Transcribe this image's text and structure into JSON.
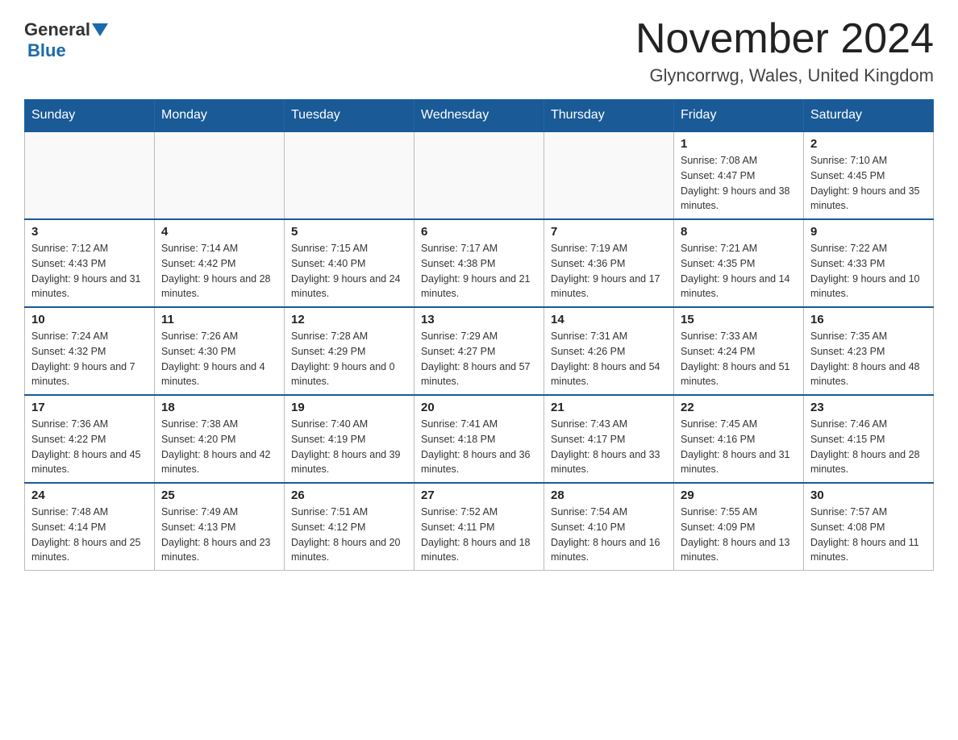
{
  "header": {
    "logo_general": "General",
    "logo_blue": "Blue",
    "month_year": "November 2024",
    "location": "Glyncorrwg, Wales, United Kingdom"
  },
  "weekdays": [
    "Sunday",
    "Monday",
    "Tuesday",
    "Wednesday",
    "Thursday",
    "Friday",
    "Saturday"
  ],
  "weeks": [
    [
      {
        "day": "",
        "info": ""
      },
      {
        "day": "",
        "info": ""
      },
      {
        "day": "",
        "info": ""
      },
      {
        "day": "",
        "info": ""
      },
      {
        "day": "",
        "info": ""
      },
      {
        "day": "1",
        "info": "Sunrise: 7:08 AM\nSunset: 4:47 PM\nDaylight: 9 hours and 38 minutes."
      },
      {
        "day": "2",
        "info": "Sunrise: 7:10 AM\nSunset: 4:45 PM\nDaylight: 9 hours and 35 minutes."
      }
    ],
    [
      {
        "day": "3",
        "info": "Sunrise: 7:12 AM\nSunset: 4:43 PM\nDaylight: 9 hours and 31 minutes."
      },
      {
        "day": "4",
        "info": "Sunrise: 7:14 AM\nSunset: 4:42 PM\nDaylight: 9 hours and 28 minutes."
      },
      {
        "day": "5",
        "info": "Sunrise: 7:15 AM\nSunset: 4:40 PM\nDaylight: 9 hours and 24 minutes."
      },
      {
        "day": "6",
        "info": "Sunrise: 7:17 AM\nSunset: 4:38 PM\nDaylight: 9 hours and 21 minutes."
      },
      {
        "day": "7",
        "info": "Sunrise: 7:19 AM\nSunset: 4:36 PM\nDaylight: 9 hours and 17 minutes."
      },
      {
        "day": "8",
        "info": "Sunrise: 7:21 AM\nSunset: 4:35 PM\nDaylight: 9 hours and 14 minutes."
      },
      {
        "day": "9",
        "info": "Sunrise: 7:22 AM\nSunset: 4:33 PM\nDaylight: 9 hours and 10 minutes."
      }
    ],
    [
      {
        "day": "10",
        "info": "Sunrise: 7:24 AM\nSunset: 4:32 PM\nDaylight: 9 hours and 7 minutes."
      },
      {
        "day": "11",
        "info": "Sunrise: 7:26 AM\nSunset: 4:30 PM\nDaylight: 9 hours and 4 minutes."
      },
      {
        "day": "12",
        "info": "Sunrise: 7:28 AM\nSunset: 4:29 PM\nDaylight: 9 hours and 0 minutes."
      },
      {
        "day": "13",
        "info": "Sunrise: 7:29 AM\nSunset: 4:27 PM\nDaylight: 8 hours and 57 minutes."
      },
      {
        "day": "14",
        "info": "Sunrise: 7:31 AM\nSunset: 4:26 PM\nDaylight: 8 hours and 54 minutes."
      },
      {
        "day": "15",
        "info": "Sunrise: 7:33 AM\nSunset: 4:24 PM\nDaylight: 8 hours and 51 minutes."
      },
      {
        "day": "16",
        "info": "Sunrise: 7:35 AM\nSunset: 4:23 PM\nDaylight: 8 hours and 48 minutes."
      }
    ],
    [
      {
        "day": "17",
        "info": "Sunrise: 7:36 AM\nSunset: 4:22 PM\nDaylight: 8 hours and 45 minutes."
      },
      {
        "day": "18",
        "info": "Sunrise: 7:38 AM\nSunset: 4:20 PM\nDaylight: 8 hours and 42 minutes."
      },
      {
        "day": "19",
        "info": "Sunrise: 7:40 AM\nSunset: 4:19 PM\nDaylight: 8 hours and 39 minutes."
      },
      {
        "day": "20",
        "info": "Sunrise: 7:41 AM\nSunset: 4:18 PM\nDaylight: 8 hours and 36 minutes."
      },
      {
        "day": "21",
        "info": "Sunrise: 7:43 AM\nSunset: 4:17 PM\nDaylight: 8 hours and 33 minutes."
      },
      {
        "day": "22",
        "info": "Sunrise: 7:45 AM\nSunset: 4:16 PM\nDaylight: 8 hours and 31 minutes."
      },
      {
        "day": "23",
        "info": "Sunrise: 7:46 AM\nSunset: 4:15 PM\nDaylight: 8 hours and 28 minutes."
      }
    ],
    [
      {
        "day": "24",
        "info": "Sunrise: 7:48 AM\nSunset: 4:14 PM\nDaylight: 8 hours and 25 minutes."
      },
      {
        "day": "25",
        "info": "Sunrise: 7:49 AM\nSunset: 4:13 PM\nDaylight: 8 hours and 23 minutes."
      },
      {
        "day": "26",
        "info": "Sunrise: 7:51 AM\nSunset: 4:12 PM\nDaylight: 8 hours and 20 minutes."
      },
      {
        "day": "27",
        "info": "Sunrise: 7:52 AM\nSunset: 4:11 PM\nDaylight: 8 hours and 18 minutes."
      },
      {
        "day": "28",
        "info": "Sunrise: 7:54 AM\nSunset: 4:10 PM\nDaylight: 8 hours and 16 minutes."
      },
      {
        "day": "29",
        "info": "Sunrise: 7:55 AM\nSunset: 4:09 PM\nDaylight: 8 hours and 13 minutes."
      },
      {
        "day": "30",
        "info": "Sunrise: 7:57 AM\nSunset: 4:08 PM\nDaylight: 8 hours and 11 minutes."
      }
    ]
  ]
}
